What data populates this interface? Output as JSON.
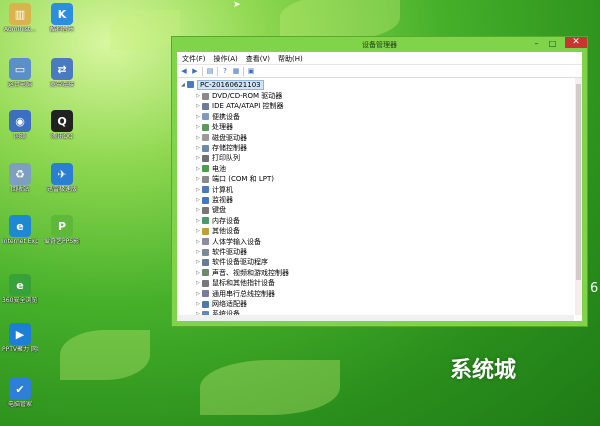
{
  "desktop_icons": [
    {
      "name": "administrator-icon",
      "label": "Administ...",
      "color": "#d8b44a",
      "glyph": "▥"
    },
    {
      "name": "kuaidu-icon",
      "label": "酷狗音乐",
      "color": "#2c8ee0",
      "glyph": "K"
    },
    {
      "name": "computer-icon",
      "label": "这台电脑",
      "color": "#5b8fc7",
      "glyph": "▭"
    },
    {
      "name": "network-icon",
      "label": "宽带连接",
      "color": "#4a7bc0",
      "glyph": "⇄"
    },
    {
      "name": "network2-icon",
      "label": "网络",
      "color": "#3d6fbf",
      "glyph": "◉"
    },
    {
      "name": "qq-icon",
      "label": "腾讯QQ",
      "color": "#222222",
      "glyph": "Q"
    },
    {
      "name": "recycle-icon",
      "label": "回收站",
      "color": "#7f9fbf",
      "glyph": "♻"
    },
    {
      "name": "xunlei-icon",
      "label": "迅雷极速版",
      "color": "#2b7fd0",
      "glyph": "✈"
    },
    {
      "name": "ie-icon",
      "label": "Internet Explorer",
      "color": "#1e88d0",
      "glyph": "e"
    },
    {
      "name": "pps-icon",
      "label": "爱奇艺PPS影音",
      "color": "#5fb83a",
      "glyph": "P"
    },
    {
      "name": "360-icon",
      "label": "360安全浏览器",
      "color": "#38a23a",
      "glyph": "e"
    },
    {
      "name": "pptv-icon",
      "label": "PPTV聚力 网络电视",
      "color": "#1b7fd6",
      "glyph": "▶"
    },
    {
      "name": "guard-icon",
      "label": "电脑管家",
      "color": "#2e7fd8",
      "glyph": "✔"
    }
  ],
  "window": {
    "title": "设备管理器",
    "minimize": "–",
    "maximize": "□",
    "close": "✕",
    "menu": [
      "文件(F)",
      "操作(A)",
      "查看(V)",
      "帮助(H)"
    ],
    "toolbar": [
      "back-icon",
      "forward-icon",
      "properties-icon",
      "help-icon",
      "list-icon",
      "display-icon"
    ],
    "root": "PC-20160621103",
    "nodes": [
      {
        "label": "DVD/CD-ROM 驱动器",
        "color": "#8a8a8a"
      },
      {
        "label": "IDE ATA/ATAPI 控制器",
        "color": "#6a7aa0"
      },
      {
        "label": "便携设备",
        "color": "#7a9ac0"
      },
      {
        "label": "处理器",
        "color": "#5a9a5a"
      },
      {
        "label": "磁盘驱动器",
        "color": "#9a9a9a"
      },
      {
        "label": "存储控制器",
        "color": "#6a8ab0"
      },
      {
        "label": "打印队列",
        "color": "#707070"
      },
      {
        "label": "电池",
        "color": "#4aa04a"
      },
      {
        "label": "端口 (COM 和 LPT)",
        "color": "#8a8a8a"
      },
      {
        "label": "计算机",
        "color": "#4a7ac0"
      },
      {
        "label": "监视器",
        "color": "#3a7ac8"
      },
      {
        "label": "键盘",
        "color": "#777777"
      },
      {
        "label": "内存设备",
        "color": "#4a9a6a"
      },
      {
        "label": "其他设备",
        "color": "#c0a030"
      },
      {
        "label": "人体学输入设备",
        "color": "#8a8aa0"
      },
      {
        "label": "软件驱动器",
        "color": "#7a8a9a"
      },
      {
        "label": "软件设备驱动程序",
        "color": "#6a7a9a"
      },
      {
        "label": "声音、视频和游戏控制器",
        "color": "#6a8a6a"
      },
      {
        "label": "鼠标和其他指针设备",
        "color": "#777777"
      },
      {
        "label": "通用串行总线控制器",
        "color": "#7a7a9a"
      },
      {
        "label": "网络适配器",
        "color": "#4a7ab0"
      },
      {
        "label": "系统设备",
        "color": "#5a8ac0"
      }
    ]
  },
  "watermark": "系统城",
  "side_text": "6"
}
